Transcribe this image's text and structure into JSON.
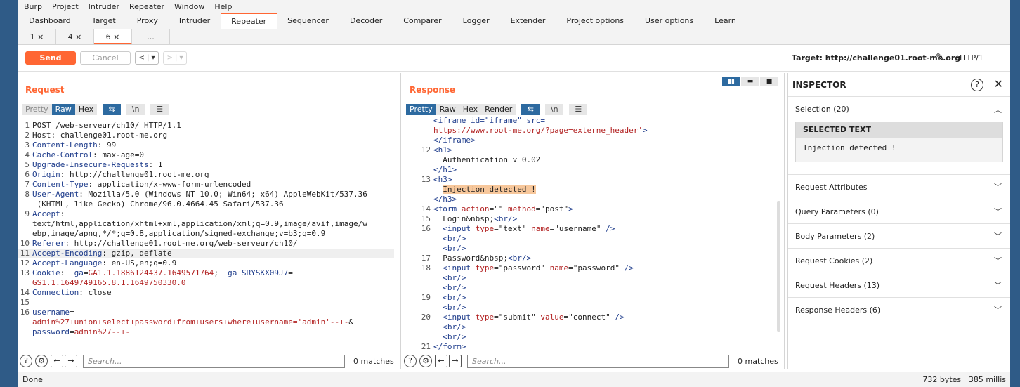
{
  "menu": [
    "Burp",
    "Project",
    "Intruder",
    "Repeater",
    "Window",
    "Help"
  ],
  "main_tabs": [
    "Dashboard",
    "Target",
    "Proxy",
    "Intruder",
    "Repeater",
    "Sequencer",
    "Decoder",
    "Comparer",
    "Logger",
    "Extender",
    "Project options",
    "User options",
    "Learn"
  ],
  "active_main_tab": "Repeater",
  "sub_tabs": [
    "1 ×",
    "4 ×",
    "6 ×",
    "..."
  ],
  "toolbar": {
    "send": "Send",
    "cancel": "Cancel",
    "prev": "< | ▾",
    "next": "> | ▾",
    "target": "Target: http://challenge01.root-me.org",
    "http_version": "HTTP/1"
  },
  "request": {
    "title": "Request",
    "view_tabs": [
      "Pretty",
      "Raw",
      "Hex"
    ],
    "active_tab": "Raw",
    "icons": [
      "wrap-icon",
      "newline-icon",
      "menu-icon"
    ],
    "lines": [
      {
        "n": "1",
        "parts": [
          [
            "POST /web-serveur/ch10/ HTTP/1.1",
            ""
          ]
        ]
      },
      {
        "n": "2",
        "parts": [
          [
            "Host",
            ""
          ],
          [
            ": challenge01.root-me.org",
            ""
          ]
        ]
      },
      {
        "n": "3",
        "parts": [
          [
            "Content-Length",
            "k"
          ],
          [
            ": 99",
            ""
          ]
        ]
      },
      {
        "n": "4",
        "parts": [
          [
            "Cache-Control",
            "k"
          ],
          [
            ": max-age=0",
            ""
          ]
        ]
      },
      {
        "n": "5",
        "parts": [
          [
            "Upgrade-Insecure-Requests",
            "k"
          ],
          [
            ": 1",
            ""
          ]
        ]
      },
      {
        "n": "6",
        "parts": [
          [
            "Origin",
            "k"
          ],
          [
            ": http://challenge01.root-me.org",
            ""
          ]
        ]
      },
      {
        "n": "7",
        "parts": [
          [
            "Content-Type",
            "k"
          ],
          [
            ": application/x-www-form-urlencoded",
            ""
          ]
        ]
      },
      {
        "n": "8",
        "parts": [
          [
            "User-Agent",
            "k"
          ],
          [
            ": Mozilla/5.0 (Windows NT 10.0; Win64; x64) AppleWebKit/537.36",
            ""
          ]
        ]
      },
      {
        "n": "",
        "parts": [
          [
            " (KHTML, like Gecko) Chrome/96.0.4664.45 Safari/537.36",
            ""
          ]
        ]
      },
      {
        "n": "9",
        "parts": [
          [
            "Accept",
            "k"
          ],
          [
            ":",
            ""
          ]
        ]
      },
      {
        "n": "",
        "parts": [
          [
            "text/html,application/xhtml+xml,application/xml;q=0.9,image/avif,image/w",
            ""
          ]
        ]
      },
      {
        "n": "",
        "parts": [
          [
            "ebp,image/apng,*/*;q=0.8,application/signed-exchange;v=b3;q=0.9",
            ""
          ]
        ]
      },
      {
        "n": "10",
        "parts": [
          [
            "Referer",
            "k"
          ],
          [
            ": http://challenge01.root-me.org/web-serveur/ch10/",
            ""
          ]
        ]
      },
      {
        "n": "11",
        "parts": [
          [
            "Accept-Encoding",
            "k"
          ],
          [
            ": gzip, deflate",
            ""
          ]
        ],
        "hl": true
      },
      {
        "n": "12",
        "parts": [
          [
            "Accept-Language",
            "k"
          ],
          [
            ": en-US,en;q=0.9",
            ""
          ]
        ]
      },
      {
        "n": "13",
        "parts": [
          [
            "Cookie",
            "k"
          ],
          [
            ": ",
            ""
          ],
          [
            "_ga",
            "k"
          ],
          [
            "=",
            ""
          ],
          [
            "GA1.1.1886124437.1649571764",
            "v"
          ],
          [
            "; ",
            ""
          ],
          [
            "_ga_SRYSKX09J7",
            "k"
          ],
          [
            "=",
            ""
          ]
        ]
      },
      {
        "n": "",
        "parts": [
          [
            "GS1.1.1649749165.8.1.1649750330.0",
            "v"
          ]
        ]
      },
      {
        "n": "14",
        "parts": [
          [
            "Connection",
            "k"
          ],
          [
            ": close",
            ""
          ]
        ]
      },
      {
        "n": "15",
        "parts": [
          [
            "",
            ""
          ]
        ]
      },
      {
        "n": "16",
        "parts": [
          [
            "username",
            "k"
          ],
          [
            "=",
            ""
          ]
        ]
      },
      {
        "n": "",
        "parts": [
          [
            "admin%27+union+select+password+from+users+where+username='admin'--+-",
            "v"
          ],
          [
            "&",
            ""
          ]
        ]
      },
      {
        "n": "",
        "parts": [
          [
            "password",
            "k"
          ],
          [
            "=",
            ""
          ],
          [
            "admin%27--+-",
            "v"
          ]
        ]
      }
    ],
    "search_placeholder": "Search...",
    "matches": "0 matches"
  },
  "response": {
    "title": "Response",
    "view_tabs": [
      "Pretty",
      "Raw",
      "Hex",
      "Render"
    ],
    "active_tab": "Pretty",
    "lines": [
      {
        "n": "",
        "parts": [
          [
            "<iframe id=\"iframe\" src=",
            "tag"
          ]
        ]
      },
      {
        "n": "",
        "parts": [
          [
            "https://www.root-me.org/?page=externe_header'",
            "attr"
          ],
          [
            ">",
            "tag"
          ]
        ]
      },
      {
        "n": "",
        "parts": [
          [
            "</iframe>",
            "tag"
          ]
        ]
      },
      {
        "n": "12",
        "parts": [
          [
            "<h1>",
            "tag"
          ]
        ]
      },
      {
        "n": "",
        "parts": [
          [
            "  Authentication v 0.02",
            ""
          ]
        ]
      },
      {
        "n": "",
        "parts": [
          [
            "</h1>",
            "tag"
          ]
        ]
      },
      {
        "n": "13",
        "parts": [
          [
            "<h3>",
            "tag"
          ]
        ]
      },
      {
        "n": "",
        "parts": [
          [
            "  ",
            ""
          ],
          [
            "Injection detected !",
            "hl"
          ]
        ]
      },
      {
        "n": "",
        "parts": [
          [
            "</h3>",
            "tag"
          ]
        ]
      },
      {
        "n": "14",
        "parts": [
          [
            "<form ",
            "tag"
          ],
          [
            "action",
            "attr"
          ],
          [
            "=\"\" ",
            ""
          ],
          [
            "method",
            "attr"
          ],
          [
            "=\"post\"",
            ""
          ],
          [
            ">",
            "tag"
          ]
        ]
      },
      {
        "n": "15",
        "parts": [
          [
            "  Login&nbsp;",
            ""
          ],
          [
            "<br/>",
            "tag"
          ]
        ]
      },
      {
        "n": "16",
        "parts": [
          [
            "  ",
            ""
          ],
          [
            "<input ",
            "tag"
          ],
          [
            "type",
            "attr"
          ],
          [
            "=\"text\" ",
            ""
          ],
          [
            "name",
            "attr"
          ],
          [
            "=\"username\" ",
            ""
          ],
          [
            "/>",
            "tag"
          ]
        ]
      },
      {
        "n": "",
        "parts": [
          [
            "  ",
            ""
          ],
          [
            "<br/>",
            "tag"
          ]
        ]
      },
      {
        "n": "",
        "parts": [
          [
            "  ",
            ""
          ],
          [
            "<br/>",
            "tag"
          ]
        ]
      },
      {
        "n": "17",
        "parts": [
          [
            "  Password&nbsp;",
            ""
          ],
          [
            "<br/>",
            "tag"
          ]
        ]
      },
      {
        "n": "18",
        "parts": [
          [
            "  ",
            ""
          ],
          [
            "<input ",
            "tag"
          ],
          [
            "type",
            "attr"
          ],
          [
            "=\"password\" ",
            ""
          ],
          [
            "name",
            "attr"
          ],
          [
            "=\"password\" ",
            ""
          ],
          [
            "/>",
            "tag"
          ]
        ]
      },
      {
        "n": "",
        "parts": [
          [
            "  ",
            ""
          ],
          [
            "<br/>",
            "tag"
          ]
        ]
      },
      {
        "n": "",
        "parts": [
          [
            "  ",
            ""
          ],
          [
            "<br/>",
            "tag"
          ]
        ]
      },
      {
        "n": "19",
        "parts": [
          [
            "  ",
            ""
          ],
          [
            "<br/>",
            "tag"
          ]
        ]
      },
      {
        "n": "",
        "parts": [
          [
            "  ",
            ""
          ],
          [
            "<br/>",
            "tag"
          ]
        ]
      },
      {
        "n": "20",
        "parts": [
          [
            "  ",
            ""
          ],
          [
            "<input ",
            "tag"
          ],
          [
            "type",
            "attr"
          ],
          [
            "=\"submit\" ",
            ""
          ],
          [
            "value",
            "attr"
          ],
          [
            "=\"connect\" ",
            ""
          ],
          [
            "/>",
            "tag"
          ]
        ]
      },
      {
        "n": "",
        "parts": [
          [
            "  ",
            ""
          ],
          [
            "<br/>",
            "tag"
          ]
        ]
      },
      {
        "n": "",
        "parts": [
          [
            "  ",
            ""
          ],
          [
            "<br/>",
            "tag"
          ]
        ]
      },
      {
        "n": "21",
        "parts": [
          [
            "</form>",
            "tag"
          ]
        ]
      }
    ],
    "search_placeholder": "Search...",
    "matches": "0 matches"
  },
  "inspector": {
    "title": "INSPECTOR",
    "selection": "Selection (20)",
    "selected_text_label": "SELECTED TEXT",
    "selected_text": "Injection detected !",
    "sections": [
      "Request Attributes",
      "Query Parameters (0)",
      "Body Parameters (2)",
      "Request Cookies (2)",
      "Request Headers (13)",
      "Response Headers (6)"
    ]
  },
  "status": {
    "left": "Done",
    "right": "732 bytes | 385 millis"
  }
}
